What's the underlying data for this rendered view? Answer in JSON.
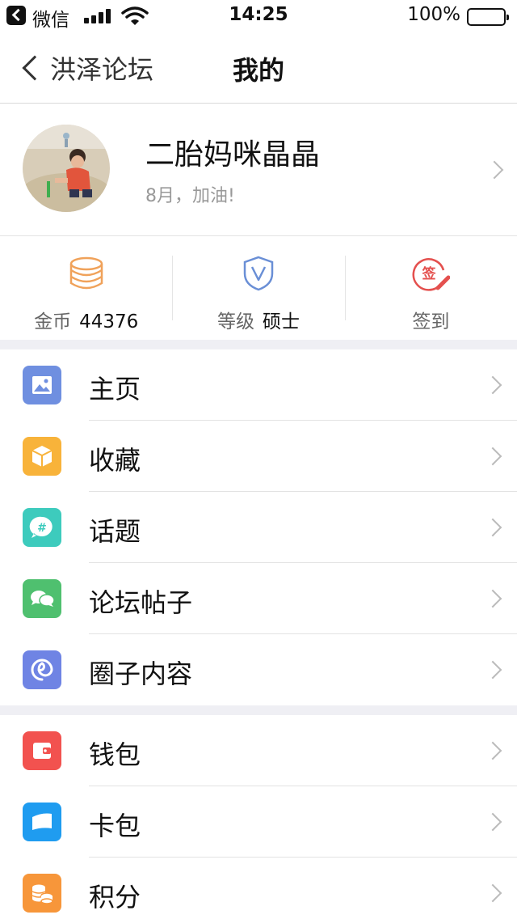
{
  "status_bar": {
    "back_app": "微信",
    "time": "14:25",
    "battery_percent": "100%",
    "battery_level": 1.0,
    "signal_bars": 4
  },
  "nav": {
    "back_label": "洪泽论坛",
    "title": "我的"
  },
  "profile": {
    "name": "二胎妈咪晶晶",
    "subtitle": "8月，加油!"
  },
  "stats": [
    {
      "label": "金币",
      "value": "44376",
      "icon": "coins-icon",
      "color": "#f0a25a"
    },
    {
      "label": "等级",
      "value": "硕士",
      "icon": "shield-v-icon",
      "color": "#6a8fd6"
    },
    {
      "label": "签到",
      "value": "",
      "icon": "sign-in-icon",
      "color": "#e4504e"
    }
  ],
  "menu_groups": [
    [
      {
        "label": "主页",
        "icon": "picture-icon",
        "color": "#6f8fe0"
      },
      {
        "label": "收藏",
        "icon": "box-icon",
        "color": "#f8b33a"
      },
      {
        "label": "话题",
        "icon": "hashtag-bubble-icon",
        "color": "#3dcbbd"
      },
      {
        "label": "论坛帖子",
        "icon": "chat-bubbles-icon",
        "color": "#4fc06f"
      },
      {
        "label": "圈子内容",
        "icon": "swirl-icon",
        "color": "#6f84e4"
      }
    ],
    [
      {
        "label": "钱包",
        "icon": "wallet-icon",
        "color": "#f2524f"
      },
      {
        "label": "卡包",
        "icon": "card-icon",
        "color": "#1f9cf0"
      },
      {
        "label": "积分",
        "icon": "coin-stack-icon",
        "color": "#f7963a"
      }
    ]
  ]
}
